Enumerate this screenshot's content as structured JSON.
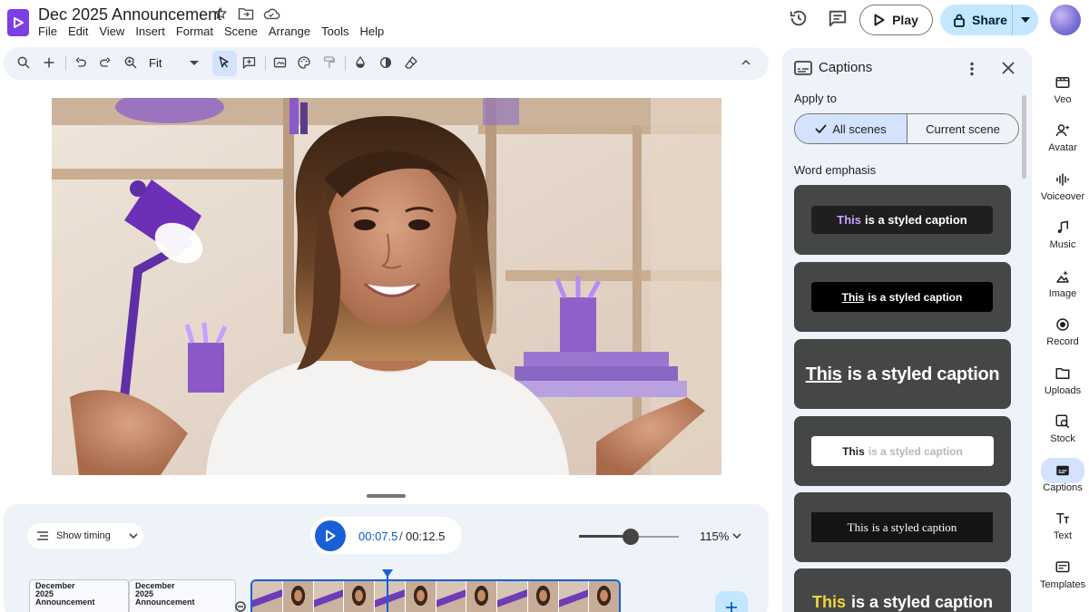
{
  "document": {
    "title": "Dec 2025 Announcement"
  },
  "menu": [
    "File",
    "Edit",
    "View",
    "Insert",
    "Format",
    "Scene",
    "Arrange",
    "Tools",
    "Help"
  ],
  "header": {
    "play_label": "Play",
    "share_label": "Share"
  },
  "toolbar": {
    "zoom_label": "Fit"
  },
  "timeline": {
    "show_timing_label": "Show timing",
    "current_time": "00:07.5",
    "separator": "/",
    "total_time": "00:12.5",
    "zoom_percent": "115%",
    "zoom_level": 0.52,
    "clips": [
      {
        "line1": "December",
        "line2": "2025",
        "line3": "Announcement"
      },
      {
        "line1": "December",
        "line2": "2025",
        "line3": "Announcement"
      }
    ]
  },
  "captions_panel": {
    "title": "Captions",
    "apply_to_label": "Apply to",
    "scope_options": [
      "All scenes",
      "Current scene"
    ],
    "selected_scope": "All scenes",
    "word_emphasis_label": "Word emphasis",
    "styles": [
      {
        "first": "This",
        "rest": "is a styled caption"
      },
      {
        "first": "This",
        "rest": "is a styled caption"
      },
      {
        "first": "This",
        "rest": "is a styled caption"
      },
      {
        "first": "This",
        "rest": "is a styled caption"
      },
      {
        "first": "This",
        "rest": "is a styled caption"
      },
      {
        "first": "This",
        "rest": "is a styled caption"
      }
    ]
  },
  "rail": [
    "Veo",
    "Avatar",
    "Voiceover",
    "Music",
    "Image",
    "Record",
    "Uploads",
    "Stock",
    "Captions",
    "Text",
    "Templates"
  ],
  "rail_active": "Captions",
  "colors": {
    "accent": "#1a5fd6",
    "brand": "#7b3fe4",
    "share_bg": "#c2e7ff",
    "panel_bg": "#eef2f9",
    "caption_highlight": "#c9a3ff",
    "caption_yellow": "#f4d43a"
  }
}
